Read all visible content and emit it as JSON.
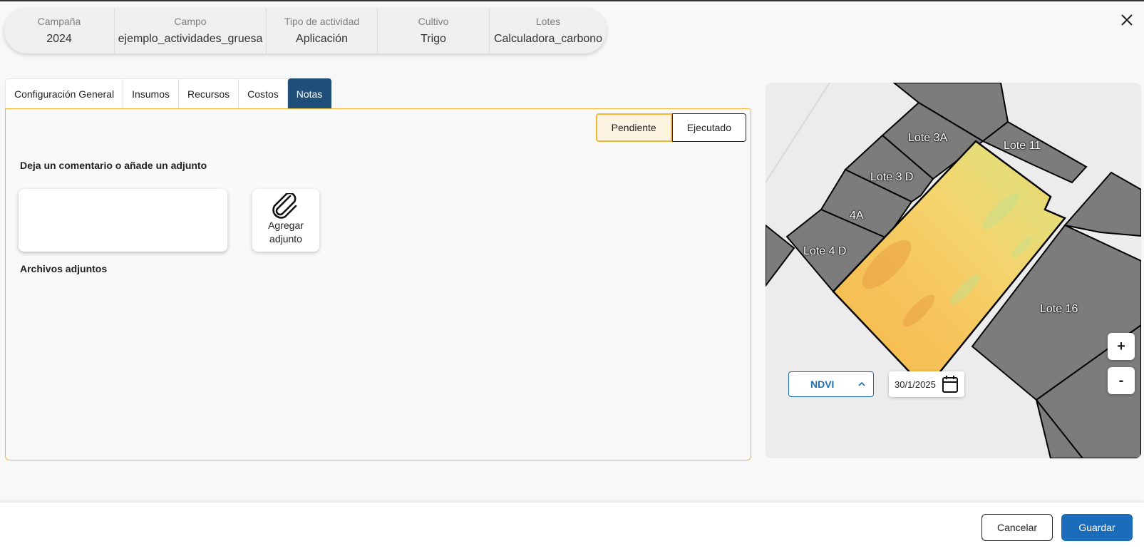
{
  "summary": {
    "campana": {
      "label": "Campaña",
      "value": "2024"
    },
    "campo": {
      "label": "Campo",
      "value": "ejemplo_actividades_gruesa"
    },
    "tipo": {
      "label": "Tipo de actividad",
      "value": "Aplicación"
    },
    "cultivo": {
      "label": "Cultivo",
      "value": "Trigo"
    },
    "lotes": {
      "label": "Lotes",
      "value": "Calculadora_carbono"
    }
  },
  "tabs": [
    {
      "label": "Configuración General"
    },
    {
      "label": "Insumos"
    },
    {
      "label": "Recursos"
    },
    {
      "label": "Costos"
    },
    {
      "label": "Notas"
    }
  ],
  "active_tab": "Notas",
  "status": {
    "pending": "Pendiente",
    "executed": "Ejecutado",
    "selected": "Pendiente"
  },
  "notes": {
    "comment_title": "Deja un comentario o añade un adjunto",
    "comment_value": "",
    "attach_label": "Agregar adjunto",
    "attachments_title": "Archivos adjuntos"
  },
  "map": {
    "lotes": [
      "Lote 3A",
      "Lote 11",
      "Lote 3 D",
      "4A",
      "Lote 4 D",
      "Lote 16"
    ],
    "layer": "NDVI",
    "date": "30/1/2025",
    "zoom_in": "+",
    "zoom_out": "-"
  },
  "footer": {
    "cancel": "Cancelar",
    "save": "Guardar"
  },
  "colors": {
    "accent": "#1b6dbb",
    "active_tab": "#1f4e79",
    "highlight": "#f2b632"
  },
  "icons": [
    "close-icon",
    "paperclip-icon",
    "chevron-up-icon",
    "calendar-icon"
  ]
}
